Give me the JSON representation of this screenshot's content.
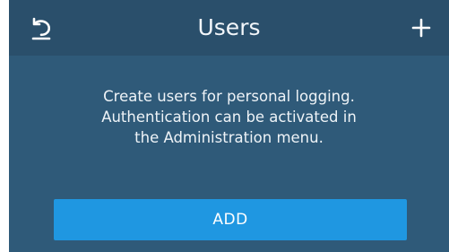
{
  "header": {
    "title": "Users",
    "back_icon": "back-arrow-icon",
    "add_icon": "plus-icon"
  },
  "main": {
    "message_lines": [
      "Create users for personal logging.",
      "Authentication can be activated in",
      "the Administration menu."
    ],
    "add_button_label": "ADD"
  },
  "colors": {
    "background": "#2f5a79",
    "header_background": "#2a4f6b",
    "button": "#1f97e1",
    "text": "#ffffff"
  }
}
